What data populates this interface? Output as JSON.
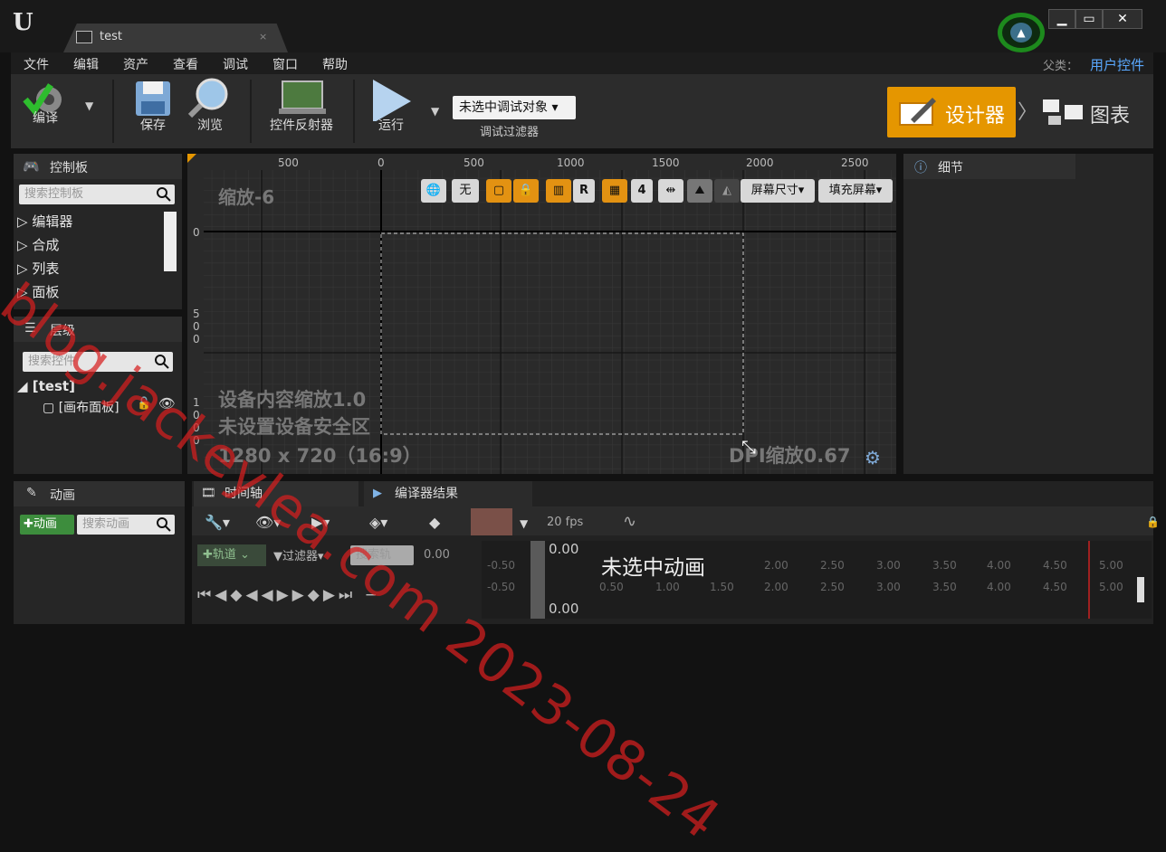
{
  "window": {
    "tab_title": "test",
    "tab_close": "×",
    "controls": {
      "minimize": "▁",
      "maximize": "▭",
      "close": "✕"
    }
  },
  "menu": {
    "items": [
      "文件",
      "编辑",
      "资产",
      "查看",
      "调试",
      "窗口",
      "帮助"
    ],
    "parent_label": "父类：",
    "parent_value": "用户控件"
  },
  "toolbar": {
    "compile": "编译",
    "save": "保存",
    "browse": "浏览",
    "widget_reflector": "控件反射器",
    "run": "运行",
    "debug_select": "未选中调试对象",
    "debug_filter": "调试过滤器",
    "designer": "设计器",
    "graph": "图表"
  },
  "palette": {
    "title": "控制板",
    "search_placeholder": "搜索控制板",
    "items": [
      "编辑器",
      "合成",
      "列表",
      "面板"
    ]
  },
  "hierarchy": {
    "title": "层级",
    "search_placeholder": "搜索控件",
    "root": "[test]",
    "child": "[画布面板]"
  },
  "viewport": {
    "ruler_top": [
      "500",
      "0",
      "500",
      "1000",
      "1500",
      "2000",
      "2500"
    ],
    "ruler_left": [
      "0",
      "5",
      "0",
      "0",
      "1",
      "0",
      "0",
      "0"
    ],
    "zoom_label": "缩放-6",
    "none_btn": "无",
    "r_btn": "R",
    "grid_num": "4",
    "screen_size": "屏幕尺寸",
    "fill_screen": "填充屏幕",
    "device_scale": "设备内容缩放1.0",
    "safe_zone": "未设置设备安全区",
    "resolution": "1280 x 720（16:9）",
    "dpi_scale": "DPI缩放0.67"
  },
  "details": {
    "title": "细节"
  },
  "animations": {
    "title": "动画",
    "add_button": "动画",
    "search_placeholder": "搜索动画"
  },
  "timeline": {
    "tab_timeline": "时间轴",
    "tab_compiler": "编译器结果",
    "fps": "20 fps",
    "track_btn": "轨道",
    "filter_btn": "过滤器",
    "search_tracks": "搜索轨",
    "time_value": "0.00",
    "playhead_top": "0.00",
    "playhead_bottom": "0.00",
    "no_animation": "未选中动画",
    "ticks": [
      "-0.50",
      "0.50",
      "1.00",
      "1.50",
      "2.00",
      "2.50",
      "3.00",
      "3.50",
      "4.00",
      "4.50",
      "5.00"
    ]
  },
  "watermark": "blog.jackeylea.com 2023-08-24",
  "colors": {
    "accent_orange": "#e59600",
    "link_blue": "#5aa9ff",
    "help_green": "#1d8a1d",
    "watermark_red": "#d71e1e"
  }
}
